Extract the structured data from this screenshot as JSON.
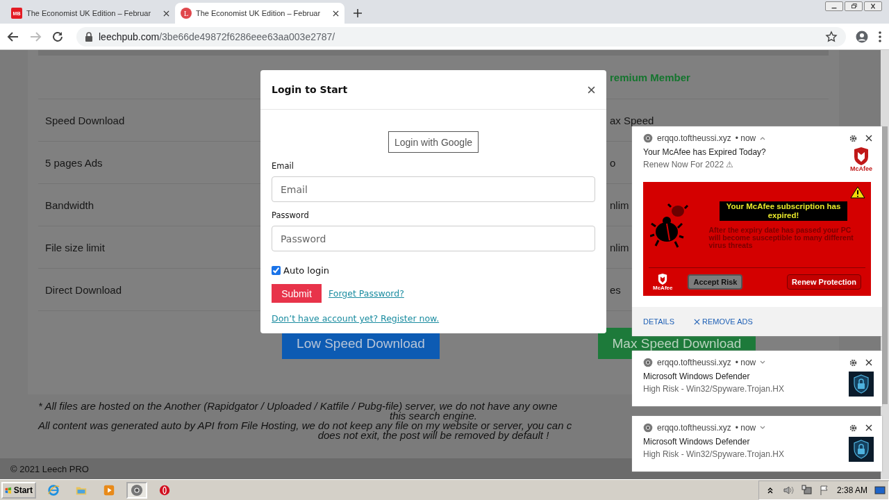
{
  "browser": {
    "tabs": [
      {
        "favicon": "MB",
        "title": "The Economist UK Edition – Februar",
        "selected": false
      },
      {
        "favicon": "L",
        "title": "The Economist UK Edition – Februar",
        "selected": true
      }
    ],
    "back_enabled": true,
    "forward_enabled": false,
    "url": {
      "host": "leechpub.com",
      "path": "/3be66de49872f6286eee63aa003e2787/"
    }
  },
  "page": {
    "header": "remium Member",
    "rows": [
      {
        "feature": "Speed Download",
        "premium": "ax Speed"
      },
      {
        "feature": "5 pages Ads",
        "premium": "o"
      },
      {
        "feature": "Bandwidth",
        "premium": "nlim"
      },
      {
        "feature": "File size limit",
        "premium": "nlim"
      },
      {
        "feature": "Direct Download",
        "premium": "es"
      }
    ],
    "buttons": [
      {
        "label": "Low Speed Download",
        "kind": "low"
      },
      {
        "label": "Max Speed Download",
        "kind": "max"
      }
    ],
    "disclaimer": [
      {
        "text": "* All files are hosted on the Another (Rapidgator / Uploaded / Katfile / Pubg-file) server, we do not have any owne",
        "kind": "left"
      },
      {
        "text": "this search engine.",
        "kind": "center"
      },
      {
        "text": "All content was generated auto by API from File Hosting, we do not keep any file on my website or server, you can c",
        "kind": "left"
      },
      {
        "text": "does not exit, the post will be removed by default !",
        "kind": "center"
      }
    ],
    "footer": "© 2021 Leech PRO"
  },
  "modal": {
    "title": "Login to Start",
    "google_button": "Login with Google",
    "fields": [
      {
        "label": "Email",
        "placeholder": "Email"
      },
      {
        "label": "Password",
        "placeholder": "Password"
      }
    ],
    "auto_login": {
      "label": "Auto login",
      "checked": true
    },
    "submit": "Submit",
    "forgot_link": "Forget Password?",
    "register_link": "Don’t have account yet? Register now."
  },
  "notifications": [
    {
      "source": "erqqo.toftheussi.xyz",
      "time": "• now",
      "expanded": true,
      "title": "Your McAfee has Expired Today?",
      "body": "Renew Now For 2022 ⚠",
      "image": {
        "kind": "mcafee",
        "caption": "McAfee"
      },
      "banner": {
        "headline": "Your McAfee subscription has expired!",
        "text": "After the expiry date has passed your PC will become susceptible to many different virus threats",
        "logo": "McAfee",
        "buttons": [
          {
            "label": "Accept Risk",
            "kind": "grey"
          },
          {
            "label": "Renew Protection",
            "kind": "red"
          }
        ]
      },
      "actions": [
        {
          "label": "DETAILS",
          "kind": "plain"
        },
        {
          "label": "REMOVE ADS",
          "kind": "remove"
        }
      ]
    },
    {
      "source": "erqqo.toftheussi.xyz",
      "time": "• now",
      "expanded": false,
      "title": "Microsoft Windows Defender",
      "body": "High Risk - Win32/Spyware.Trojan.HX",
      "image": {
        "kind": "defender"
      }
    },
    {
      "source": "erqqo.toftheussi.xyz",
      "time": "• now",
      "expanded": false,
      "title": "Microsoft Windows Defender",
      "body": "High Risk - Win32/Spyware.Trojan.HX",
      "image": {
        "kind": "defender"
      }
    }
  ],
  "taskbar": {
    "start": "Start",
    "programs": [
      {
        "kind": "ie",
        "selected": false
      },
      {
        "kind": "folder",
        "selected": false
      },
      {
        "kind": "media",
        "selected": false
      },
      {
        "kind": "chrome",
        "selected": true
      },
      {
        "kind": "opera",
        "selected": false
      }
    ],
    "clock": "2:38 AM"
  }
}
